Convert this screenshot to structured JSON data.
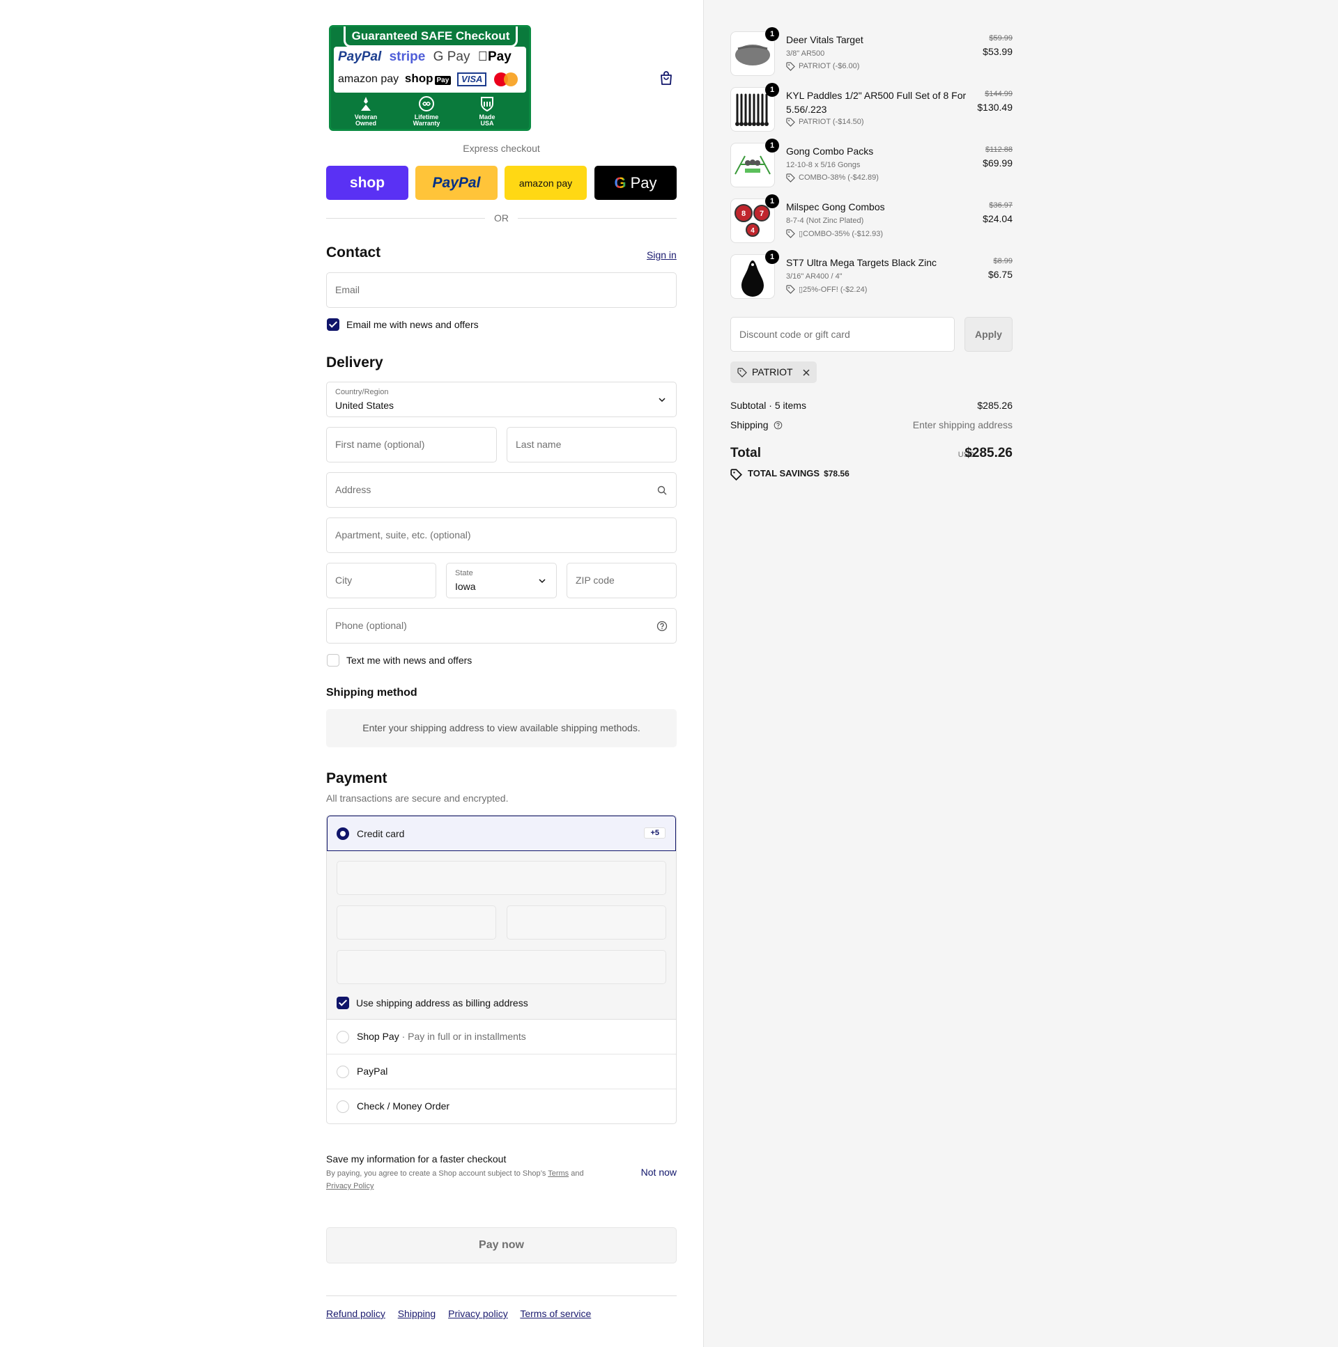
{
  "badge": {
    "title": "Guaranteed SAFE Checkout",
    "row1": [
      "PayPal",
      "stripe",
      "G Pay",
      "Pay"
    ],
    "row2": [
      "amazon pay",
      "shop",
      "Pay",
      "VISA"
    ],
    "icons": [
      {
        "line1": "Veteran",
        "line2": "Owned"
      },
      {
        "line1": "Lifetime",
        "line2": "Warranty"
      },
      {
        "line1": "Made",
        "line2": "USA"
      }
    ]
  },
  "express": {
    "label": "Express checkout",
    "shop": "shop",
    "paypal": "PayPal",
    "amazon": "amazon pay",
    "gpay": "Pay",
    "or": "OR"
  },
  "contact": {
    "heading": "Contact",
    "sign_in": "Sign in",
    "email_placeholder": "Email",
    "news_label": "Email me with news and offers"
  },
  "delivery": {
    "heading": "Delivery",
    "country_label": "Country/Region",
    "country_value": "United States",
    "first_name": "First name (optional)",
    "last_name": "Last name",
    "address": "Address",
    "apartment": "Apartment, suite, etc. (optional)",
    "city": "City",
    "state_label": "State",
    "state_value": "Iowa",
    "zip": "ZIP code",
    "phone": "Phone (optional)",
    "text_label": "Text me with news and offers"
  },
  "shipping_method": {
    "heading": "Shipping method",
    "info": "Enter your shipping address to view available shipping methods."
  },
  "payment": {
    "heading": "Payment",
    "subtitle": "All transactions are secure and encrypted.",
    "credit_card": "Credit card",
    "more_badge": "+5",
    "billing_label": "Use shipping address as billing address",
    "shop_pay": "Shop Pay",
    "shop_pay_note": "Pay in full or in installments",
    "paypal": "PayPal",
    "check": "Check / Money Order"
  },
  "save": {
    "title": "Save my information for a faster checkout",
    "desc_prefix": "By paying, you agree to create a Shop account subject to Shop’s",
    "terms": "Terms",
    "and": "and",
    "privacy": "Privacy Policy",
    "not_now": "Not now"
  },
  "pay_now": "Pay now",
  "footer": [
    "Refund policy",
    "Shipping",
    "Privacy policy",
    "Terms of service"
  ],
  "items": [
    {
      "qty": "1",
      "name": "Deer Vitals Target",
      "variant": "3/8\" AR500",
      "discount": "PATRIOT (-$6.00)",
      "old": "$59.99",
      "price": "$53.99"
    },
    {
      "qty": "1",
      "name": "KYL Paddles 1/2\" AR500 Full Set of 8 For 5.56/.223",
      "variant": "",
      "discount": "PATRIOT (-$14.50)",
      "old": "$144.99",
      "price": "$130.49"
    },
    {
      "qty": "1",
      "name": "Gong Combo Packs",
      "variant": "12-10-8 x 5/16 Gongs",
      "discount": "COMBO-38% (-$42.89)",
      "old": "$112.88",
      "price": "$69.99"
    },
    {
      "qty": "1",
      "name": "Milspec Gong Combos",
      "variant": "8-7-4 (Not Zinc Plated)",
      "discount": "▯⁠COMBO-35% (-$12.93)",
      "old": "$36.97",
      "price": "$24.04"
    },
    {
      "qty": "1",
      "name": "ST7 Ultra Mega Targets Black Zinc",
      "variant": "3/16\" AR400 / 4\"",
      "discount": "▯⁠25%-OFF! (-$2.24)",
      "old": "$8.99",
      "price": "$6.75"
    }
  ],
  "milspec_thumb": [
    "8",
    "7",
    "4"
  ],
  "discount": {
    "placeholder": "Discount code or gift card",
    "apply": "Apply",
    "chip": "PATRIOT"
  },
  "summary": {
    "subtotal_label": "Subtotal · 5 items",
    "subtotal_value": "$285.26",
    "shipping_label": "Shipping",
    "shipping_value": "Enter shipping address",
    "total_label": "Total",
    "currency": "USD",
    "total_value": "$285.26",
    "savings_label": "TOTAL SAVINGS",
    "savings_value": "$78.56"
  },
  "colors": {
    "accent": "#10156a",
    "badge_green": "#0a7a3c",
    "shop_purple": "#5a31f4",
    "paypal_yellow": "#ffc439",
    "amazon_yellow": "#ffd814"
  },
  "icons": [
    "shopping-bag-icon",
    "chevron-down-icon",
    "search-icon",
    "help-icon",
    "tag-icon",
    "close-icon"
  ]
}
